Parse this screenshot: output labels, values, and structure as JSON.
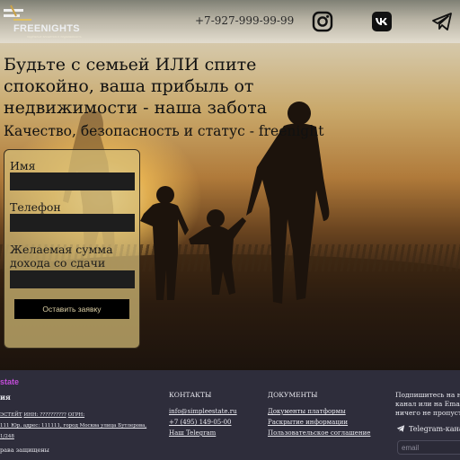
{
  "header": {
    "logo_text": "FREENIGHTS",
    "logo_tagline": "надёжные вложения в недвижимость",
    "phone": "+7-927-999-99-99",
    "social": [
      "instagram-icon",
      "vk-icon",
      "telegram-icon"
    ]
  },
  "hero": {
    "headline": "Будьте с семьей ИЛИ спите спокойно, ваша прибыль от недвижимости - наша забота",
    "subline": "Качество, безопасность и статус - freenight"
  },
  "form": {
    "name_label": "Имя",
    "phone_label": "Телефон",
    "income_label": "Желаемая сумма дохода со сдачи объекта",
    "name_value": "",
    "phone_value": "",
    "income_value": "",
    "submit_label": "Оставить заявку"
  },
  "footer": {
    "brand": "state",
    "brand_sub": "ия",
    "legal_line1_a": "ЭСТЕЙТ",
    "legal_line1_b": "ИНН: ??????????",
    "legal_line1_c": "ОГРН:",
    "legal_line2": "111 Юр. адрес: 111111, город Москва улица Бутлерова,",
    "legal_line3": "1/248",
    "rights": "рава защищены",
    "contacts": {
      "title": "КОНТАКТЫ",
      "email": "info@simpleestate.ru",
      "phone": "+7 (495) 149-05-00",
      "telegram": "Наш Telegram"
    },
    "documents": {
      "title": "ДОКУМЕНТЫ",
      "items": [
        "Документы платформы",
        "Раскрытие информации",
        "Пользовательское соглашение"
      ]
    },
    "subscribe": {
      "line1": "Подпишитесь на н",
      "line2": "канал или на Emai",
      "line3": "ничего не пропуст",
      "telegram_label": "Telegram-канал",
      "email_placeholder": "email"
    }
  },
  "colors": {
    "footer_bg": "#2e2d3b",
    "brand_accent": "#c34dd9",
    "form_bg": "#d6be78",
    "input_bg": "#1e1e1e"
  }
}
